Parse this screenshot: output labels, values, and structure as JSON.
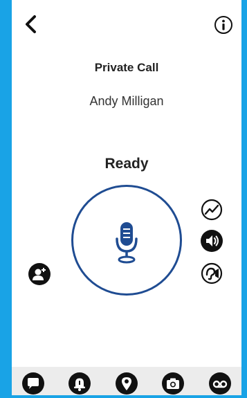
{
  "call": {
    "type_label": "Private Call",
    "contact_name": "Andy Milligan",
    "status": "Ready"
  },
  "colors": {
    "frame_background": "#19a3e6",
    "ptt_ring": "#1f4c92",
    "icon_dark": "#111111"
  },
  "icons": {
    "back": "chevron-left-icon",
    "info": "info-icon",
    "microphone": "microphone-icon",
    "add_participant": "add-person-icon",
    "signal": "signal-trend-icon",
    "speaker": "speaker-icon",
    "earpiece": "earpiece-icon"
  },
  "tabs": [
    {
      "icon": "chat-bubble-icon"
    },
    {
      "icon": "alert-icon"
    },
    {
      "icon": "location-pin-icon"
    },
    {
      "icon": "camera-icon"
    },
    {
      "icon": "voicemail-icon"
    }
  ]
}
